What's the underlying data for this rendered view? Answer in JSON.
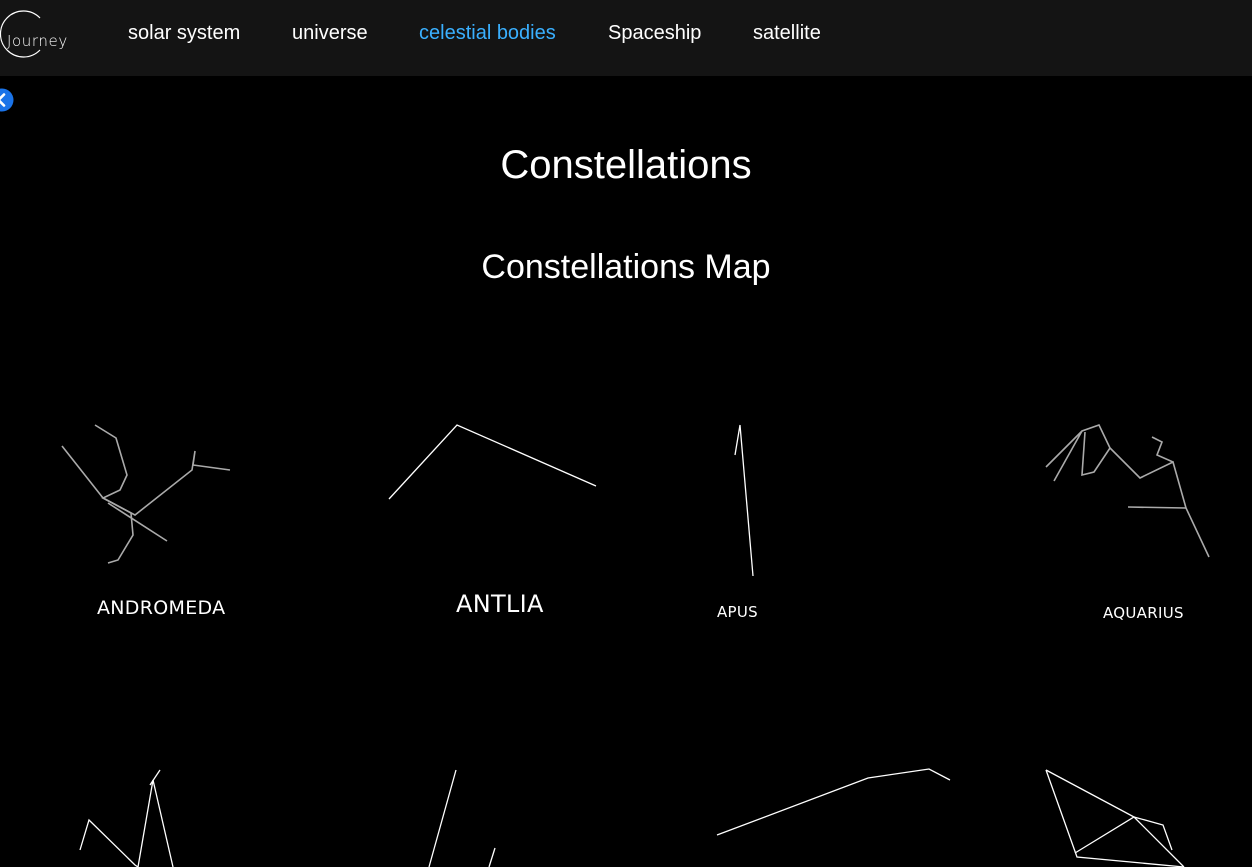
{
  "brand": {
    "logo_text": "Journey"
  },
  "nav": {
    "items": [
      {
        "label": "solar system",
        "active": false
      },
      {
        "label": "universe",
        "active": false
      },
      {
        "label": "celestial bodies",
        "active": true
      },
      {
        "label": "Spaceship",
        "active": false
      },
      {
        "label": "satellite",
        "active": false
      }
    ]
  },
  "colors": {
    "navbar_bg": "#141414",
    "page_bg": "#000000",
    "active_nav": "#3ab0ff",
    "back_button": "#1a73e8",
    "andromeda_lines": "#aaaaaa",
    "line_default": "#ffffff"
  },
  "back_button": {
    "icon": "chevron-left-circle-icon"
  },
  "page": {
    "title": "Constellations",
    "section_title": "Constellations Map"
  },
  "constellations": [
    {
      "name": "Andromeda"
    },
    {
      "name": "Antlia"
    },
    {
      "name": "Apus"
    },
    {
      "name": "Aquarius"
    },
    {
      "name": ""
    },
    {
      "name": ""
    },
    {
      "name": ""
    },
    {
      "name": ""
    }
  ]
}
